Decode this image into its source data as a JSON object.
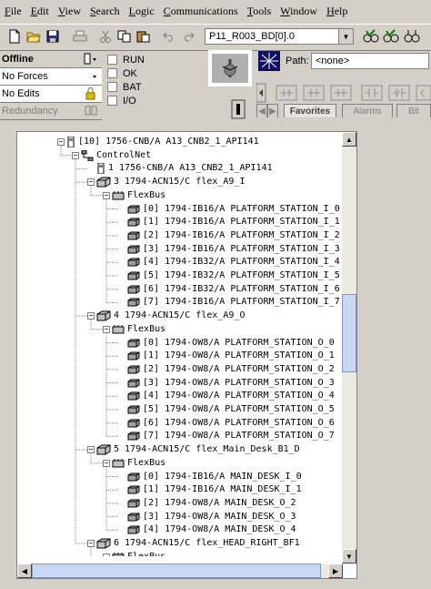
{
  "menu": [
    {
      "key": "F",
      "rest": "ile"
    },
    {
      "key": "E",
      "rest": "dit"
    },
    {
      "key": "V",
      "rest": "iew"
    },
    {
      "key": "S",
      "rest": "earch"
    },
    {
      "key": "L",
      "rest": "ogic"
    },
    {
      "key": "C",
      "rest": "ommunications"
    },
    {
      "key": "T",
      "rest": "ools"
    },
    {
      "key": "W",
      "rest": "indow"
    },
    {
      "key": "H",
      "rest": "elp"
    }
  ],
  "toolbar": {
    "routine_value": "P11_R003_BD[0].0"
  },
  "status": {
    "mode": "Offline",
    "forces": "No Forces",
    "edits": "No Edits",
    "redundancy": "Redundancy"
  },
  "indicators": [
    "RUN",
    "OK",
    "BAT",
    "I/O"
  ],
  "path": {
    "label": "Path:",
    "value": "<none>"
  },
  "tabs": [
    "Favorites",
    "Alarms",
    "Bit"
  ],
  "tree": {
    "rows": [
      {
        "text": "[10] 1756-CNB/A A13_CNB2_1_API141",
        "level": 0,
        "icon": "module-icon",
        "expander": "-"
      },
      {
        "text": "ControlNet",
        "level": 1,
        "icon": "network-icon",
        "expander": "-"
      },
      {
        "text": "1 1756-CNB/A A13_CNB2_1_API141",
        "level": 2,
        "icon": "module-icon",
        "expander": ""
      },
      {
        "text": "3 1794-ACN15/C flex_A9_I",
        "level": 2,
        "icon": "adapter-icon",
        "expander": "-"
      },
      {
        "text": "FlexBus",
        "level": 3,
        "icon": "bus-icon",
        "expander": "-"
      },
      {
        "text": "[0] 1794-IB16/A PLATFORM_STATION_I_0",
        "level": 4,
        "icon": "io-module-icon",
        "expander": ""
      },
      {
        "text": "[1] 1794-IB16/A PLATFORM_STATION_I_1",
        "level": 4,
        "icon": "io-module-icon",
        "expander": ""
      },
      {
        "text": "[2] 1794-IB16/A PLATFORM_STATION_I_2",
        "level": 4,
        "icon": "io-module-icon",
        "expander": ""
      },
      {
        "text": "[3] 1794-IB16/A PLATFORM_STATION_I_3",
        "level": 4,
        "icon": "io-module-icon",
        "expander": ""
      },
      {
        "text": "[4] 1794-IB32/A PLATFORM_STATION_I_4",
        "level": 4,
        "icon": "io-module-icon",
        "expander": ""
      },
      {
        "text": "[5] 1794-IB32/A PLATFORM_STATION_I_5",
        "level": 4,
        "icon": "io-module-icon",
        "expander": ""
      },
      {
        "text": "[6] 1794-IB32/A PLATFORM_STATION_I_6",
        "level": 4,
        "icon": "io-module-icon",
        "expander": ""
      },
      {
        "text": "[7] 1794-IB16/A PLATFORM_STATION_I_7",
        "level": 4,
        "icon": "io-module-icon",
        "expander": ""
      },
      {
        "text": "4 1794-ACN15/C flex_A9_O",
        "level": 2,
        "icon": "adapter-icon",
        "expander": "-"
      },
      {
        "text": "FlexBus",
        "level": 3,
        "icon": "bus-icon",
        "expander": "-"
      },
      {
        "text": "[0] 1794-OW8/A PLATFORM_STATION_O_0",
        "level": 4,
        "icon": "io-module-icon",
        "expander": ""
      },
      {
        "text": "[1] 1794-OW8/A PLATFORM_STATION_O_1",
        "level": 4,
        "icon": "io-module-icon",
        "expander": ""
      },
      {
        "text": "[2] 1794-OW8/A PLATFORM_STATION_O_2",
        "level": 4,
        "icon": "io-module-icon",
        "expander": ""
      },
      {
        "text": "[3] 1794-OW8/A PLATFORM_STATION_O_3",
        "level": 4,
        "icon": "io-module-icon",
        "expander": ""
      },
      {
        "text": "[4] 1794-OW8/A PLATFORM_STATION_O_4",
        "level": 4,
        "icon": "io-module-icon",
        "expander": ""
      },
      {
        "text": "[5] 1794-OW8/A PLATFORM_STATION_O_5",
        "level": 4,
        "icon": "io-module-icon",
        "expander": ""
      },
      {
        "text": "[6] 1794-OW8/A PLATFORM_STATION_O_6",
        "level": 4,
        "icon": "io-module-icon",
        "expander": ""
      },
      {
        "text": "[7] 1794-OW8/A PLATFORM_STATION_O_7",
        "level": 4,
        "icon": "io-module-icon",
        "expander": ""
      },
      {
        "text": "5 1794-ACN15/C flex_Main_Desk_B1_D",
        "level": 2,
        "icon": "adapter-icon",
        "expander": "-"
      },
      {
        "text": "FlexBus",
        "level": 3,
        "icon": "bus-icon",
        "expander": "-"
      },
      {
        "text": "[0] 1794-IB16/A MAIN_DESK_I_0",
        "level": 4,
        "icon": "io-module-icon",
        "expander": ""
      },
      {
        "text": "[1] 1794-IB16/A MAIN_DESK_I_1",
        "level": 4,
        "icon": "io-module-icon",
        "expander": ""
      },
      {
        "text": "[2] 1794-OW8/A MAIN_DESK_O_2",
        "level": 4,
        "icon": "io-module-icon",
        "expander": ""
      },
      {
        "text": "[3] 1794-OW8/A MAIN_DESK_O_3",
        "level": 4,
        "icon": "io-module-icon",
        "expander": ""
      },
      {
        "text": "[4] 1794-OW8/A MAIN_DESK_O_4",
        "level": 4,
        "icon": "io-module-icon",
        "expander": ""
      },
      {
        "text": "6 1794-ACN15/C flex_HEAD_RIGHT_BF1",
        "level": 2,
        "icon": "adapter-icon",
        "expander": "-"
      },
      {
        "text": "FlexBus",
        "level": 3,
        "icon": "bus-icon",
        "expander": "-"
      }
    ]
  }
}
